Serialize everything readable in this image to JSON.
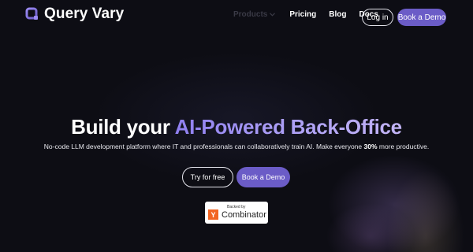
{
  "nav": {
    "brand": "Query Vary",
    "links": [
      {
        "label": "Products"
      },
      {
        "label": "Pricing"
      },
      {
        "label": "Blog"
      },
      {
        "label": "Docs"
      }
    ],
    "login_label": "Log in",
    "book_demo_label": "Book a Demo"
  },
  "hero": {
    "title_plain": "Build your ",
    "title_accent": "AI-Powered Back-Office",
    "subtitle_pre": "No-code LLM development platform where IT and professionals can collaboratively train AI. Make everyone ",
    "subtitle_bold": "30%",
    "subtitle_post": " more productive.",
    "try_label": "Try for free",
    "book_demo_label": "Book a Demo"
  },
  "badge": {
    "top": "Backed by",
    "logo_letter": "Y",
    "name": "Combinator"
  },
  "colors": {
    "background": "#0d0d14",
    "accent": "#6b5cc7",
    "gradient_start": "#8f7ff0",
    "gradient_end": "#c2b4f5",
    "yc_orange": "#f26522"
  },
  "icons": {
    "logo": "query-vary-logo-icon",
    "products_caret": "chevron-down-icon"
  }
}
